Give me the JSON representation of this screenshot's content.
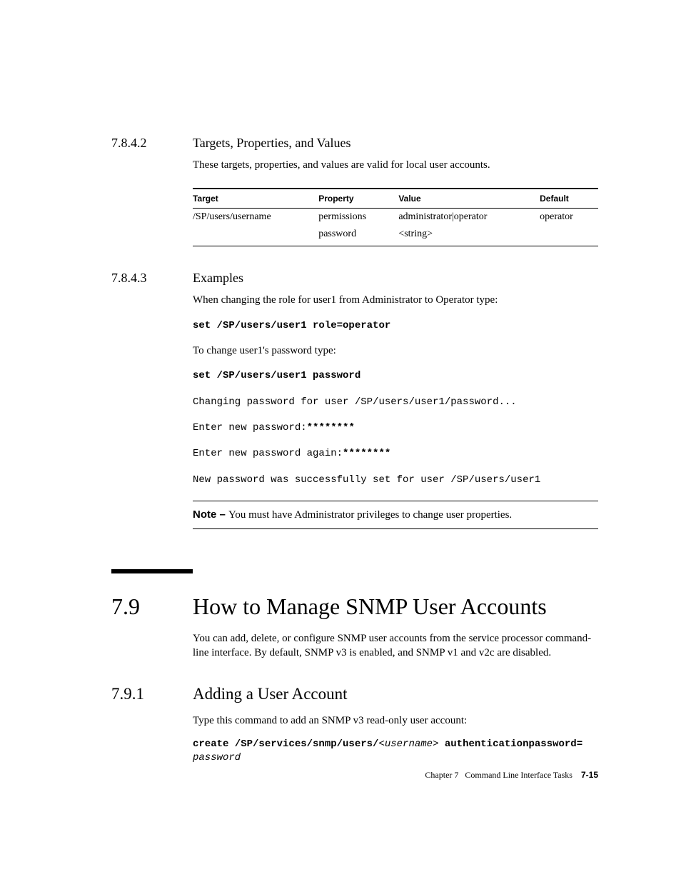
{
  "s7842": {
    "num": "7.8.4.2",
    "title": "Targets, Properties, and Values",
    "intro": "These targets, properties, and values are valid for local user accounts.",
    "table": {
      "headers": [
        "Target",
        "Property",
        "Value",
        "Default"
      ],
      "rows": [
        {
          "target": "/SP/users/username",
          "property": "permissions",
          "value": "administrator|operator",
          "default": "operator"
        },
        {
          "target": "",
          "property": "password",
          "value": "<string>",
          "default": ""
        }
      ]
    }
  },
  "s7843": {
    "num": "7.8.4.3",
    "title": "Examples",
    "p1": "When changing the role for user1 from Administrator to Operator type:",
    "cmd1": "set /SP/users/user1 role=operator",
    "p2": "To change user1's password type:",
    "cmd2": "set /SP/users/user1 password",
    "out1": "Changing password for user /SP/users/user1/password...",
    "out2a": "Enter new password:",
    "out2b": "********",
    "out3a": "Enter new password again:",
    "out3b": "********",
    "out4": "New password was successfully set for user /SP/users/user1",
    "note_label": "Note – ",
    "note_text": "You must have Administrator privileges to change user properties."
  },
  "s79": {
    "num": "7.9",
    "title": "How to Manage SNMP User Accounts",
    "intro": "You can add, delete, or configure SNMP user accounts from the service processor command-line interface. By default, SNMP v3 is enabled, and SNMP v1 and v2c are disabled."
  },
  "s791": {
    "num": "7.9.1",
    "title": "Adding a User Account",
    "intro": "Type this command to add an SNMP v3 read-only user account:",
    "cmd_b1": "create /SP/services/snmp/users/",
    "cmd_i1": "<username>",
    "cmd_b2": " authenticationpassword=",
    "cmd_i2": "password"
  },
  "footer": {
    "chapter": "Chapter 7",
    "title": "Command Line Interface Tasks",
    "page": "7-15"
  }
}
